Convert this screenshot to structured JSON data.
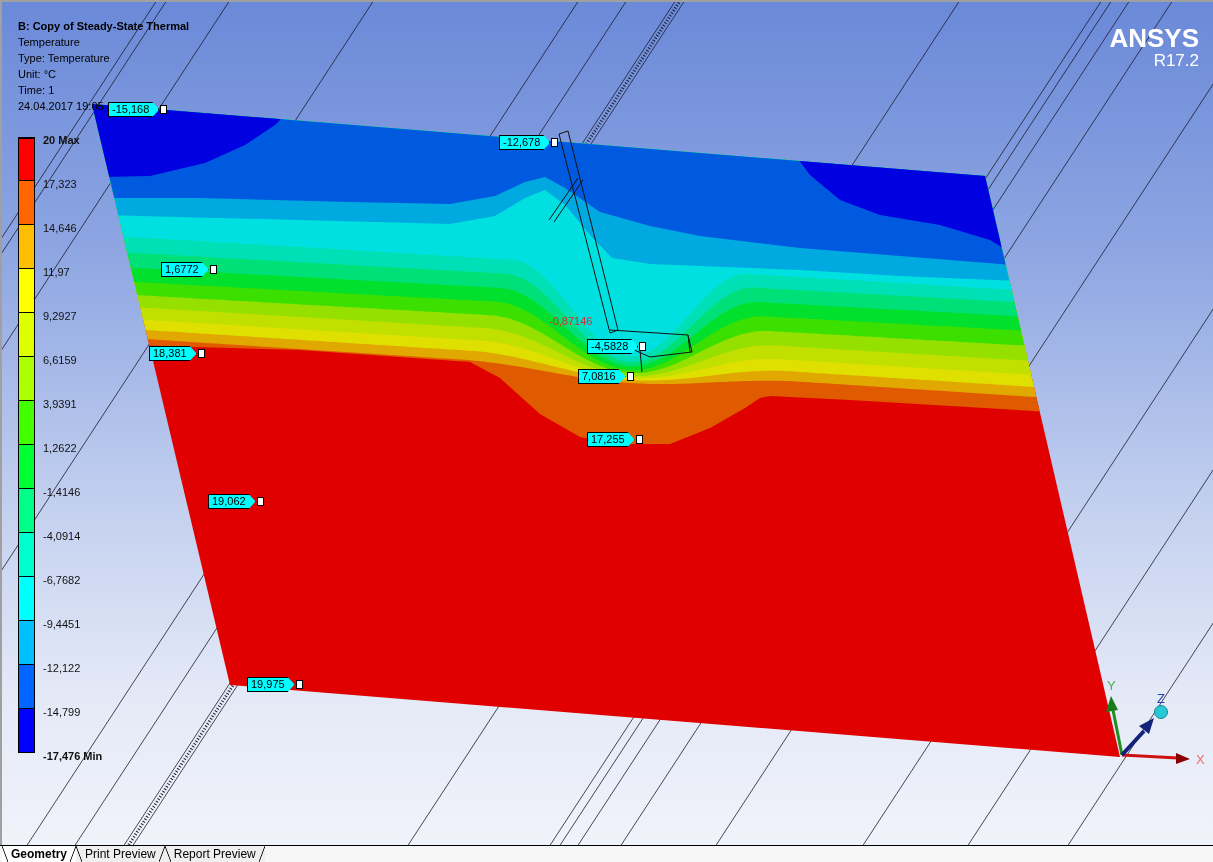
{
  "header": {
    "title": "B: Copy of Steady-State Thermal",
    "lines": [
      "Temperature",
      "Type: Temperature",
      "Unit: °C",
      "Time: 1",
      "24.04.2017 19:05"
    ]
  },
  "logo": {
    "brand": "ANSYS",
    "version": "R17.2"
  },
  "legend": {
    "bands": [
      {
        "color": "#ff0000"
      },
      {
        "color": "#ff6600"
      },
      {
        "color": "#ffbf00"
      },
      {
        "color": "#ffff00"
      },
      {
        "color": "#ddff00"
      },
      {
        "color": "#aaff00"
      },
      {
        "color": "#44ff00"
      },
      {
        "color": "#00ff33"
      },
      {
        "color": "#00ff88"
      },
      {
        "color": "#00ffd0"
      },
      {
        "color": "#00ffff"
      },
      {
        "color": "#00c0ff"
      },
      {
        "color": "#0066ff"
      },
      {
        "color": "#0000ff"
      }
    ],
    "labels": [
      {
        "text": "20 Max",
        "kind": "extreme"
      },
      {
        "text": "17,323",
        "kind": "tick"
      },
      {
        "text": "14,646",
        "kind": "tick"
      },
      {
        "text": "11,97",
        "kind": "tick"
      },
      {
        "text": "9,2927",
        "kind": "tick"
      },
      {
        "text": "6,6159",
        "kind": "tick"
      },
      {
        "text": "3,9391",
        "kind": "tick"
      },
      {
        "text": "1,2622",
        "kind": "tick"
      },
      {
        "text": "-1,4146",
        "kind": "tick"
      },
      {
        "text": "-4,0914",
        "kind": "tick"
      },
      {
        "text": "-6,7682",
        "kind": "tick"
      },
      {
        "text": "-9,4451",
        "kind": "tick"
      },
      {
        "text": "-12,122",
        "kind": "tick"
      },
      {
        "text": "-14,799",
        "kind": "tick"
      },
      {
        "text": "-17,476 Min",
        "kind": "extreme"
      }
    ]
  },
  "probes": [
    {
      "value": "-15,168",
      "kind": "tag"
    },
    {
      "value": "-12,678",
      "kind": "tag"
    },
    {
      "value": "1,6772",
      "kind": "tag"
    },
    {
      "value": "-0,87146",
      "kind": "plain"
    },
    {
      "value": "-4,5828",
      "kind": "tag"
    },
    {
      "value": "18,381",
      "kind": "tag"
    },
    {
      "value": "7,0816",
      "kind": "tag"
    },
    {
      "value": "17,255",
      "kind": "tag"
    },
    {
      "value": "19,062",
      "kind": "tag"
    },
    {
      "value": "19,975",
      "kind": "tag"
    }
  ],
  "triad": {
    "x_label": "X",
    "y_label": "Y",
    "z_label": "Z"
  },
  "tabs": [
    {
      "label": "Geometry",
      "selected": true
    },
    {
      "label": "Print Preview",
      "selected": false
    },
    {
      "label": "Report Preview",
      "selected": false
    }
  ]
}
